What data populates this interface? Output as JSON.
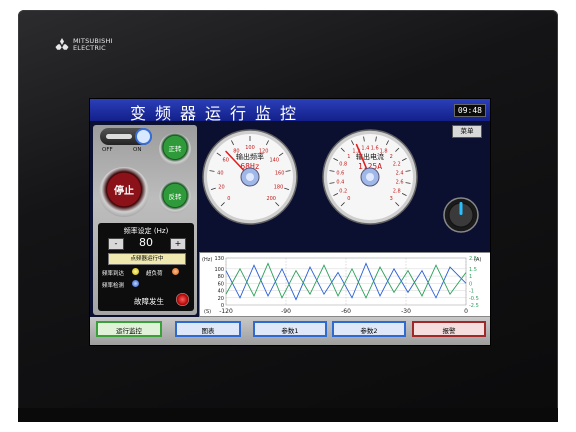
{
  "brand": {
    "line1": "MITSUBISHI",
    "line2": "ELECTRIC"
  },
  "title": "变频器运行监控",
  "clock": "09:48",
  "menu_label": "菜单",
  "switch": {
    "off_label": "OFF",
    "on_label": "ON"
  },
  "buttons": {
    "run": "正转",
    "stop": "停止",
    "reverse": "反转"
  },
  "freq_panel": {
    "title": "频率设定 (Hz)",
    "minus": "-",
    "plus": "+",
    "value": "80",
    "jog_label": "点频器运行中",
    "lamp1_label": "频率到达",
    "lamp2_label": "超负荷",
    "lamp3_label": "频率检测",
    "fault_label": "故障发生"
  },
  "gauge_freq": {
    "label": "输出频率",
    "readout": "68Hz",
    "ticks": [
      "0",
      "20",
      "40",
      "60",
      "80",
      "100",
      "120",
      "140",
      "160",
      "180",
      "200"
    ],
    "value": 68,
    "min": 0,
    "max": 200
  },
  "gauge_current": {
    "label": "输出电流",
    "readout": "1.25A",
    "ticks": [
      "0",
      "0.2",
      "0.4",
      "0.6",
      "0.8",
      "1",
      "1.2",
      "1.4",
      "1.6",
      "1.8",
      "2",
      "2.2",
      "2.4",
      "2.6",
      "2.8",
      "3"
    ],
    "value": 1.25,
    "min": 0,
    "max": 3
  },
  "colors": {
    "accent": "#13208a",
    "needle": "#e02020",
    "series_blue": "#2860d8",
    "series_green": "#2ca05a"
  },
  "chart_data": {
    "type": "line",
    "x": [
      -120,
      -113,
      -106,
      -99,
      -92,
      -85,
      -78,
      -71,
      -64,
      -57,
      -50,
      -43,
      -36,
      -29,
      -22,
      -15,
      -8,
      0
    ],
    "series": [
      {
        "values": [
          95,
          20,
          110,
          25,
          100,
          15,
          105,
          30,
          90,
          20,
          115,
          25,
          100,
          35,
          95,
          20,
          105,
          60
        ]
      },
      {
        "values": [
          30,
          100,
          25,
          115,
          20,
          95,
          30,
          110,
          25,
          100,
          20,
          105,
          35,
          95,
          25,
          110,
          30,
          90
        ]
      }
    ],
    "xlim": [
      -120,
      0
    ],
    "ylim_left": [
      0,
      130
    ],
    "ylim_right": [
      -2.5,
      2.5
    ],
    "x_ticks": [
      "-120",
      "-90",
      "-60",
      "-30",
      "0"
    ],
    "y_left_ticks": [
      "130",
      "100",
      "80",
      "60",
      "40",
      "20",
      "0"
    ],
    "y_right_ticks": [
      "2.5",
      "1.5",
      "1",
      "0",
      "-1",
      "-0.5",
      "-2.5"
    ],
    "y_left_unit": "(Hz)",
    "y_right_unit": "(A)",
    "x_unit": "(S)",
    "grid": true
  },
  "nav": {
    "run": "运行监控",
    "chart": "图表",
    "param1": "参数1",
    "param2": "参数2",
    "alarm": "报警"
  }
}
